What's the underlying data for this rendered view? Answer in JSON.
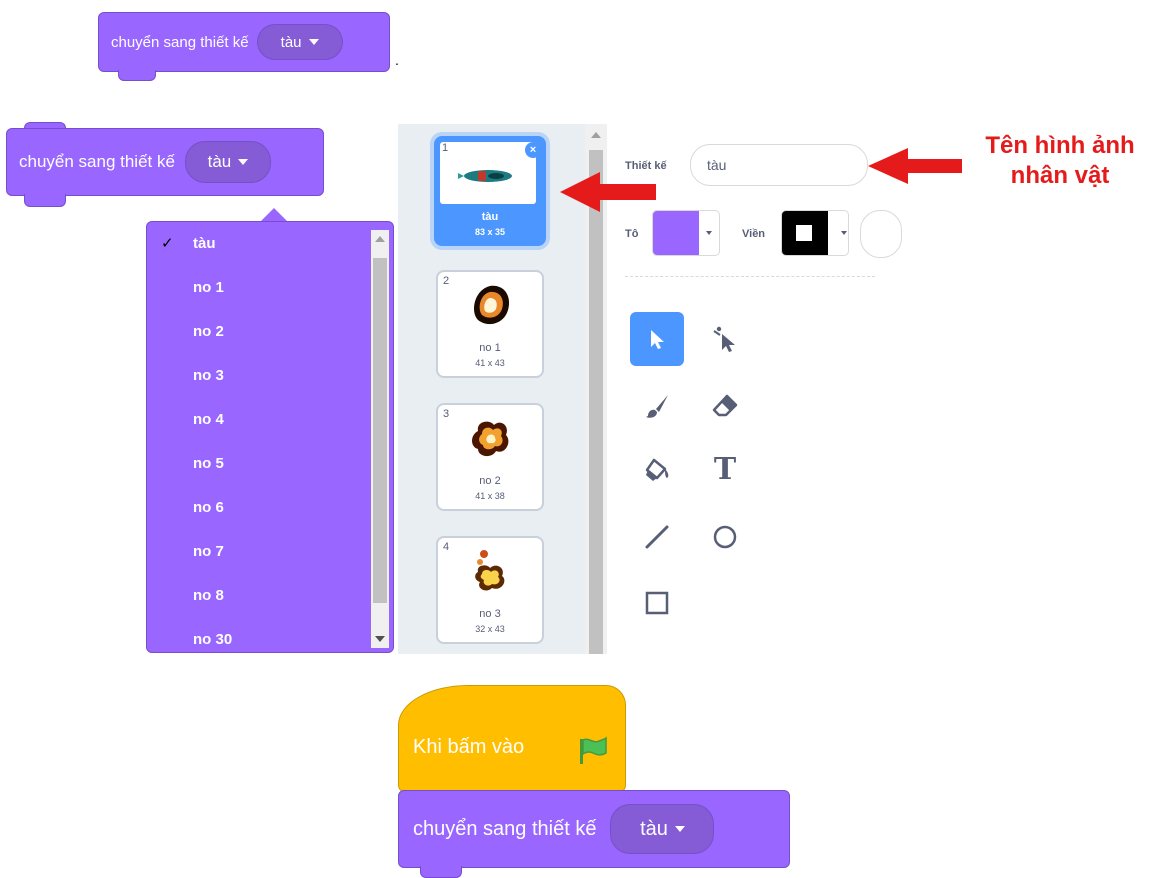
{
  "block1": {
    "text": "chuyển sang thiết kế",
    "value": "tàu"
  },
  "period": ".",
  "block2": {
    "text": "chuyển sang thiết kế",
    "value": "tàu"
  },
  "dropdown": {
    "check": "✓",
    "items": [
      "tàu",
      "no 1",
      "no 2",
      "no 3",
      "no 4",
      "no 5",
      "no 6",
      "no 7",
      "no 8",
      "no 30"
    ]
  },
  "costumes": [
    {
      "num": "1",
      "name": "tàu",
      "size": "83 x 35"
    },
    {
      "num": "2",
      "name": "no 1",
      "size": "41 x 43"
    },
    {
      "num": "3",
      "name": "no 2",
      "size": "41 x 38"
    },
    {
      "num": "4",
      "name": "no 3",
      "size": "32 x 43"
    }
  ],
  "editor": {
    "costume_label": "Thiết kế",
    "costume_value": "tàu",
    "fill_label": "Tô",
    "outline_label": "Viền",
    "fill_color": "#9966ff",
    "outline_color": "#000000"
  },
  "annotation": {
    "line1": "Tên hình ảnh",
    "line2": "nhân vật",
    "color": "#e51b1b"
  },
  "event_block": {
    "text": "Khi bấm vào",
    "icon": "green-flag-icon"
  },
  "block3": {
    "text": "chuyển sang thiết kế",
    "value": "tàu"
  }
}
